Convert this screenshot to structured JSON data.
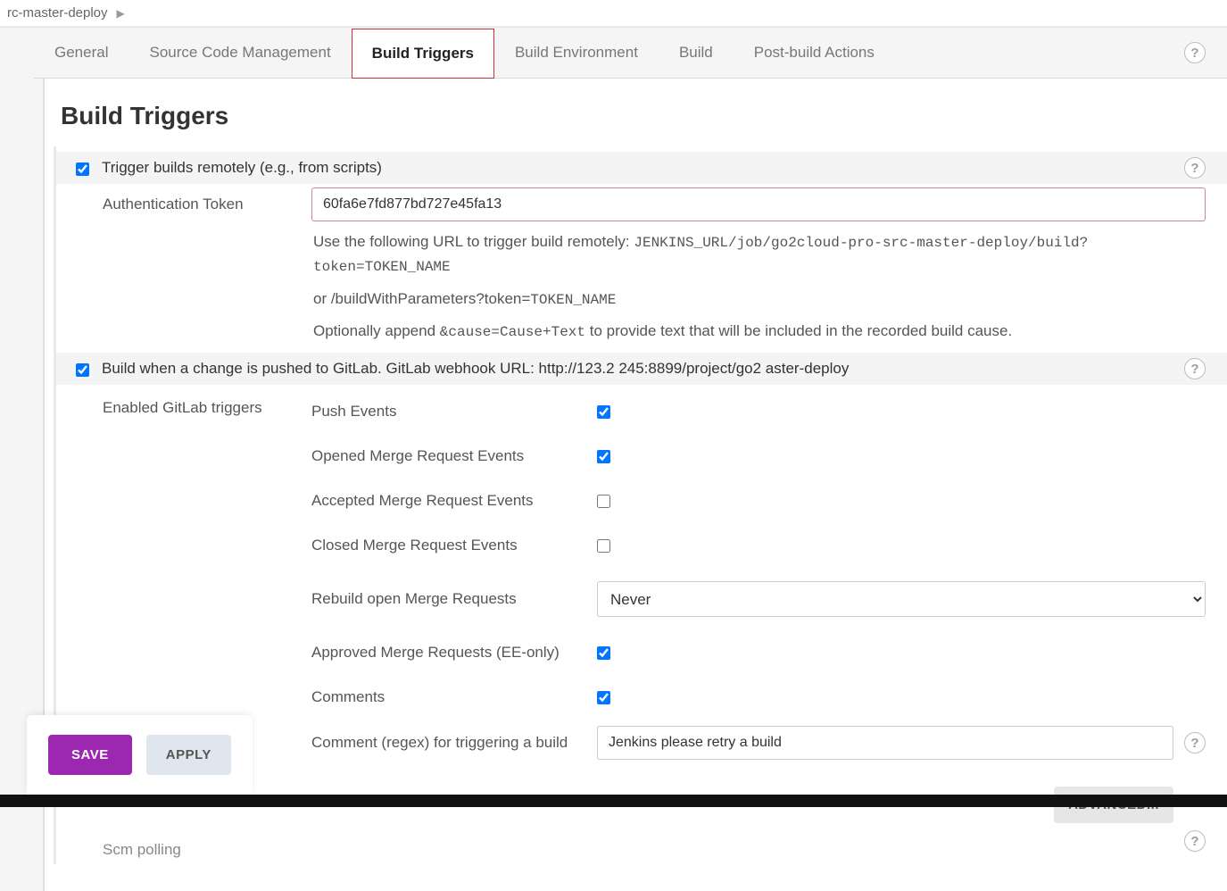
{
  "breadcrumb": {
    "item": "rc-master-deploy"
  },
  "tabs": {
    "general": "General",
    "scm": "Source Code Management",
    "triggers": "Build Triggers",
    "env": "Build Environment",
    "build": "Build",
    "post": "Post-build Actions"
  },
  "section": {
    "title": "Build Triggers"
  },
  "remote": {
    "label": "Trigger builds remotely (e.g., from scripts)",
    "checked": true,
    "token_label": "Authentication Token",
    "token_value": "60fa6e7fd877bd727e45fa13",
    "hint1_pre": "Use the following URL to trigger build remotely: ",
    "hint1_mono": "JENKINS_URL/job/go2cloud-pro-src-master-deploy/build?token=TOKEN_NAME",
    "hint2_pre": "or /buildWithParameters?token=",
    "hint2_mono": "TOKEN_NAME",
    "hint3_pre": "Optionally append ",
    "hint3_mono": "&cause=Cause+Text",
    "hint3_post": " to provide text that will be included in the recorded build cause."
  },
  "gitlab": {
    "label": "Build when a change is pushed to GitLab. GitLab webhook URL: http://123.2         245:8899/project/go2                           aster-deploy",
    "checked": true,
    "group_label": "Enabled GitLab triggers",
    "triggers": {
      "push": {
        "label": "Push Events",
        "checked": true
      },
      "opened": {
        "label": "Opened Merge Request Events",
        "checked": true
      },
      "accepted": {
        "label": "Accepted Merge Request Events",
        "checked": false
      },
      "closed": {
        "label": "Closed Merge Request Events",
        "checked": false
      },
      "rebuild": {
        "label": "Rebuild open Merge Requests",
        "value": "Never"
      },
      "approved": {
        "label": "Approved Merge Requests (EE-only)",
        "checked": true
      },
      "comments": {
        "label": "Comments",
        "checked": true
      }
    },
    "comment_regex": {
      "label": "Comment (regex) for triggering a build",
      "value": "Jenkins please retry a build"
    }
  },
  "advanced_btn": "ADVANCED...",
  "scm_polling": "Scm polling",
  "actions": {
    "save": "SAVE",
    "apply": "APPLY"
  }
}
